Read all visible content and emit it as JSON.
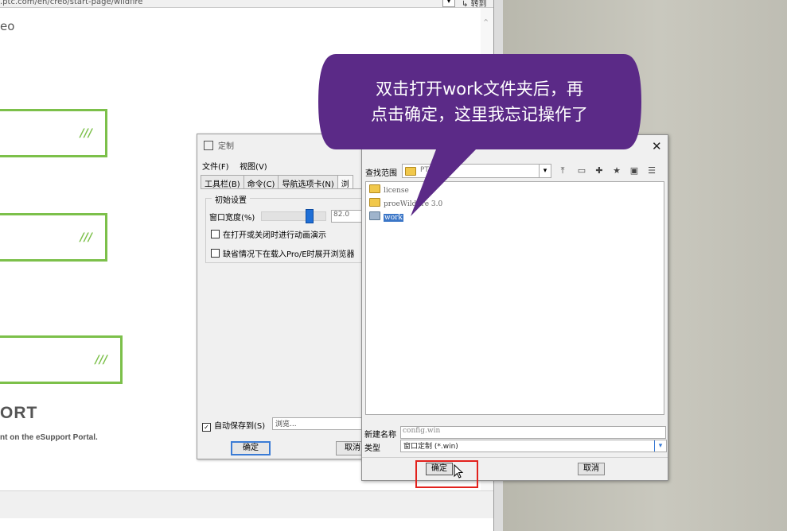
{
  "browser": {
    "url": ".ptc.com/en/creo/start-page/wildfire",
    "go_label": "转到",
    "logo": "eo",
    "card_mark": "///",
    "support_title": "ORT",
    "support_text": "nt on the eSupport Portal."
  },
  "customize": {
    "title": "定制",
    "menu": [
      "文件(F)",
      "视图(V)"
    ],
    "tabs": [
      "工具栏(B)",
      "命令(C)",
      "导航选项卡(N)",
      "浏"
    ],
    "group_title": "初始设置",
    "width_label": "窗口宽度(%)",
    "width_value": "82.0",
    "option1": "在打开或关闭时进行动画演示",
    "option2": "缺省情况下在载入Pro/E时展开浏览器",
    "autosave_label": "自动保存到(S)",
    "autosave_path": "浏览...",
    "ok_label": "确定",
    "cancel_label": "取消"
  },
  "file_dialog": {
    "look_in_label": "查找范围",
    "look_in_value": "PTC",
    "items": [
      {
        "name": "license",
        "selected": false
      },
      {
        "name": "proeWildfire 3.0",
        "selected": false
      },
      {
        "name": "work",
        "selected": true
      }
    ],
    "filename_label": "新建名称",
    "filename_value": "config.win",
    "type_label": "类型",
    "type_value": "窗口定制 (*.win)",
    "ok_label": "确定",
    "cancel_label": "取消",
    "close_glyph": "✕"
  },
  "callout": {
    "line1": "双击打开work文件夹后，再",
    "line2": "点击确定，这里我忘记操作了",
    "color": "#5b2a87"
  }
}
